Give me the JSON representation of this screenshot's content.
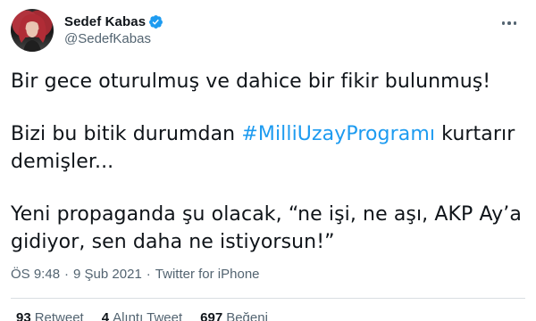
{
  "user": {
    "display_name": "Sedef Kabas",
    "handle": "@SedefKabas",
    "verified_icon": "verified-badge-icon",
    "accent_color": "#1d9bf0"
  },
  "tweet": {
    "line1": "Bir gece oturulmuş ve dahice bir fikir bulunmuş!",
    "line2_pre": "Bizi bu bitik durumdan ",
    "hashtag": "#MilliUzayProgramı",
    "line2_post": " kurtarır demişler...",
    "line3": "Yeni propaganda şu olacak, “ne işi, ne aşı, AKP Ay’a gidiyor, sen daha ne istiyorsun!”"
  },
  "meta": {
    "time": "ÖS 9:48",
    "separator": "·",
    "date": "9 Şub 2021",
    "source": "Twitter for iPhone"
  },
  "stats": {
    "retweets_count": "93",
    "retweets_label": "Retweet",
    "quotes_count": "4",
    "quotes_label": "Alıntı Tweet",
    "likes_count": "697",
    "likes_label": "Beğeni"
  }
}
